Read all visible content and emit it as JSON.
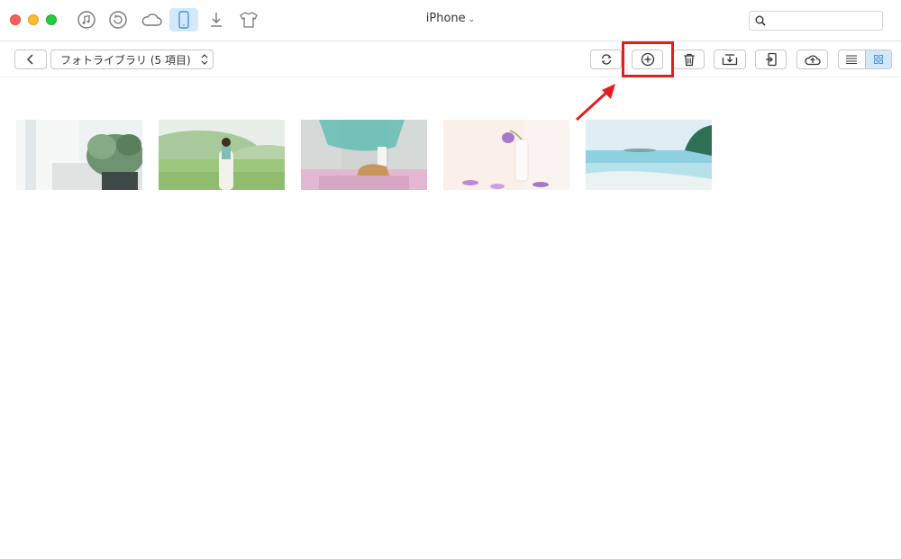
{
  "titlebar": {
    "device_name": "iPhone",
    "device_chevron": "⌄",
    "search": {
      "placeholder": "",
      "icon": "search-icon"
    },
    "nav_icons": [
      "music-icon",
      "restore-icon",
      "icloud-icon",
      "iphone-icon",
      "download-icon",
      "tshirt-icon"
    ],
    "active_nav": "iphone-icon"
  },
  "toolbar": {
    "back_icon": "chevron-left-icon",
    "album_label": "フォトライブラリ (5 項目)",
    "actions": [
      "refresh-icon",
      "add-icon",
      "trash-icon",
      "export-to-computer-icon",
      "import-to-device-icon",
      "upload-cloud-icon"
    ],
    "view_modes": [
      "list-view-icon",
      "grid-view-icon"
    ],
    "active_view": "grid-view-icon"
  },
  "annotation": {
    "highlight_color": "#e41e1e",
    "target": "add-icon"
  },
  "photos": [
    {
      "name": "plant-by-window",
      "palette": [
        "#e9eef0",
        "#6f9270"
      ]
    },
    {
      "name": "girl-in-field",
      "palette": [
        "#c6dcc0",
        "#8fbc6f"
      ]
    },
    {
      "name": "teal-dress-shoes",
      "palette": [
        "#cfd6d4",
        "#63bdb4"
      ]
    },
    {
      "name": "purple-tulip-vase",
      "palette": [
        "#fbece6",
        "#a27bc8"
      ]
    },
    {
      "name": "sea-beach",
      "palette": [
        "#cfe6ef",
        "#6fc3d6"
      ]
    }
  ],
  "colors": {
    "accent": "#d2e9fb",
    "highlight": "#e41e1e"
  }
}
